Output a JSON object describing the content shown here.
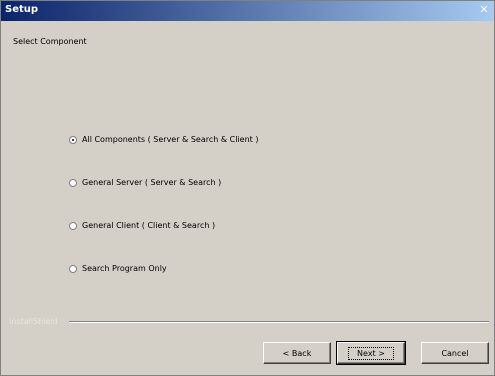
{
  "window": {
    "title": "Setup",
    "close_glyph": "✕"
  },
  "header": {
    "label": "Select Component"
  },
  "options": [
    {
      "label": "All Components ( Server & Search & Client )",
      "selected": true
    },
    {
      "label": "General Server ( Server & Search )",
      "selected": false
    },
    {
      "label": "General Client ( Client & Search )",
      "selected": false
    },
    {
      "label": "Search Program Only",
      "selected": false
    }
  ],
  "footer": {
    "brand": "InstallShield"
  },
  "buttons": {
    "back": "< Back",
    "next": "Next >",
    "cancel": "Cancel"
  },
  "colors": {
    "face": "#d4d0c8",
    "title_start": "#0a246a",
    "title_end": "#a6caf0"
  }
}
